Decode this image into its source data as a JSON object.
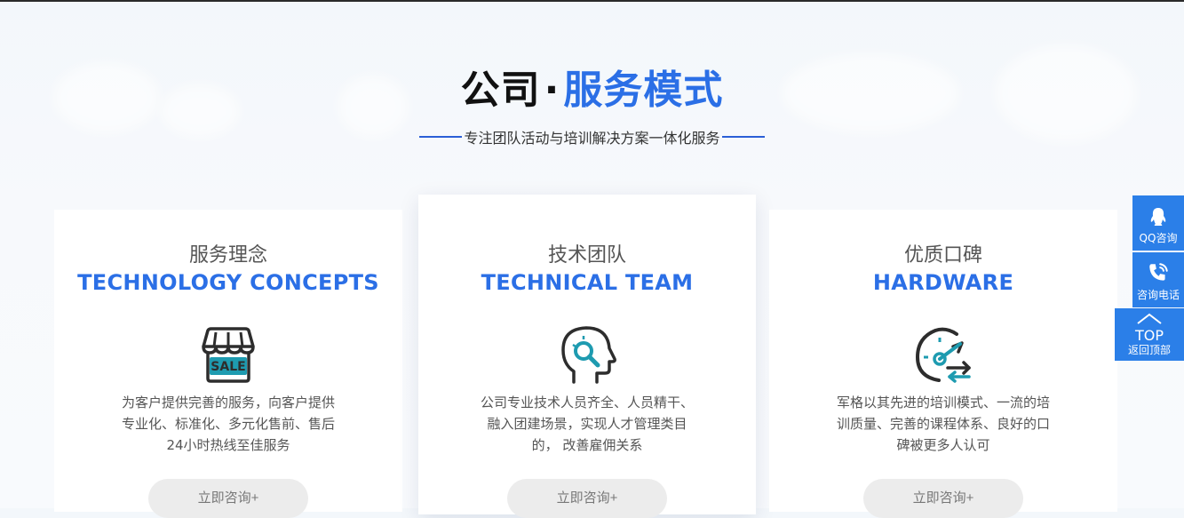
{
  "section": {
    "title_dark": "公司",
    "title_dot": "·",
    "title_blue": "服务模式",
    "subtitle": "专注团队活动与培训解决方案一体化服务"
  },
  "cards": [
    {
      "title_cn": "服务理念",
      "title_en": "TECHNOLOGY CONCEPTS",
      "icon": "sale-shop-icon",
      "icon_text": "SALE",
      "desc": [
        "为客户提供完善的服务，向客户提供",
        "专业化、标准化、多元化售前、售后",
        "24小时热线至佳服务"
      ],
      "button": "立即咨询+"
    },
    {
      "title_cn": "技术团队",
      "title_en": "TECHNICAL TEAM",
      "icon": "head-search-icon",
      "desc": [
        "公司专业技术人员齐全、人员精干、",
        "融入团建场景，实现人才管理类目",
        "的， 改善雇佣关系"
      ],
      "button": "立即咨询+"
    },
    {
      "title_cn": "优质口碑",
      "title_en": "HARDWARE",
      "icon": "gauge-arrows-icon",
      "desc": [
        "军格以其先进的培训模式、一流的培",
        "训质量、完善的课程体系、良好的口",
        "碑被更多人认可"
      ],
      "button": "立即咨询+"
    }
  ],
  "sidebar": {
    "qq_label": "QQ咨询",
    "tel_label": "咨询电话",
    "top_text": "TOP",
    "top_label": "返回顶部"
  },
  "colors": {
    "accent": "#2b6fe6",
    "sidebar": "#2b7fe8",
    "icon_teal": "#1e9bb0",
    "icon_dark": "#2d2d2d"
  }
}
